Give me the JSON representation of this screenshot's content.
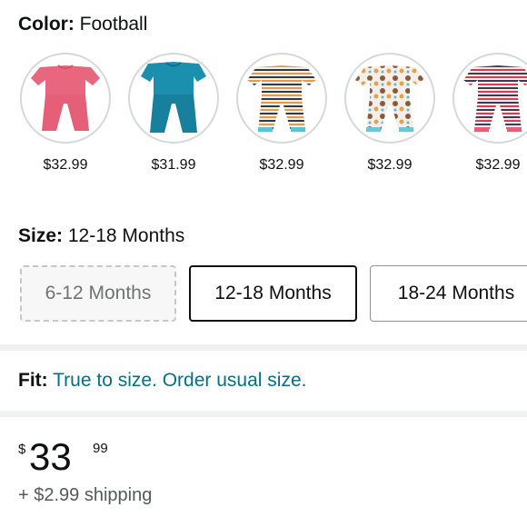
{
  "color": {
    "label": "Color:",
    "value": "Football",
    "swatches": [
      {
        "price": "$32.99",
        "icon": "pink-pajama-set-image",
        "fill": "#e8667e",
        "pattern": "solid"
      },
      {
        "price": "$31.99",
        "icon": "teal-pajama-set-image",
        "fill": "#1b8fae",
        "pattern": "solid"
      },
      {
        "price": "$32.99",
        "icon": "striped-pajama-set-image",
        "fill": "#f4f0e6",
        "pattern": "stripes"
      },
      {
        "price": "$32.99",
        "icon": "patterned-pajama-set-image",
        "fill": "#f1ece6",
        "pattern": "dots"
      },
      {
        "price": "$32.99",
        "icon": "red-striped-pajama-set-image",
        "fill": "#f6ece4",
        "pattern": "redstripes"
      }
    ]
  },
  "size": {
    "label": "Size:",
    "value": "12-18 Months",
    "options": [
      {
        "label": "6-12 Months",
        "state": "unavailable"
      },
      {
        "label": "12-18 Months",
        "state": "selected"
      },
      {
        "label": "18-24 Months",
        "state": "available"
      }
    ]
  },
  "fit": {
    "label": "Fit:",
    "text": "True to size. Order usual size."
  },
  "price": {
    "symbol": "$",
    "whole": "33",
    "fraction": "99"
  },
  "shipping": "+ $2.99 shipping"
}
